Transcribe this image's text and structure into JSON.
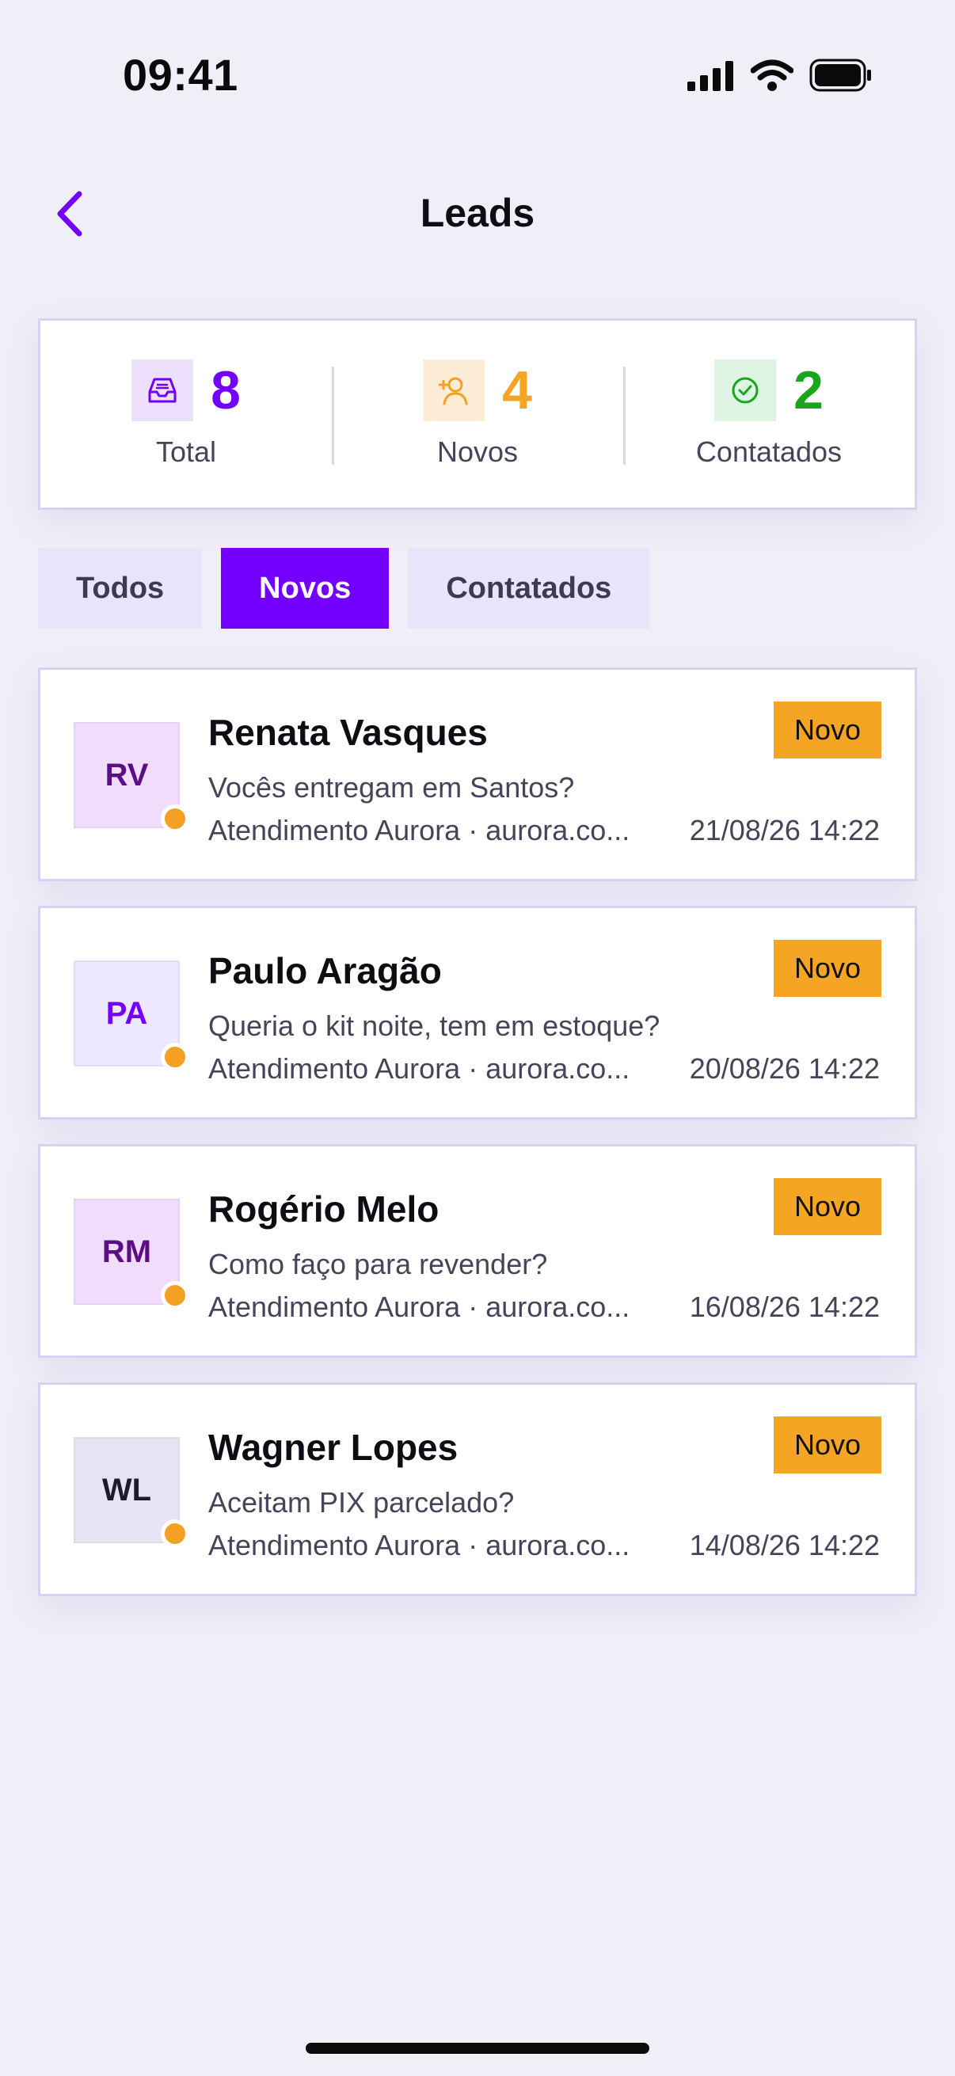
{
  "status_bar": {
    "time": "09:41"
  },
  "nav": {
    "title": "Leads"
  },
  "colors": {
    "accent": "#7300ff",
    "novo": "#f5a524",
    "contacted": "#1aa51a"
  },
  "stats": [
    {
      "value": "8",
      "label": "Total",
      "icon": "inbox-icon",
      "color": "#7300ff"
    },
    {
      "value": "4",
      "label": "Novos",
      "icon": "user-plus-icon",
      "color": "#f5a524"
    },
    {
      "value": "2",
      "label": "Contatados",
      "icon": "check-circle-icon",
      "color": "#1aa51a"
    }
  ],
  "tabs": [
    {
      "label": "Todos",
      "active": false
    },
    {
      "label": "Novos",
      "active": true
    },
    {
      "label": "Contatados",
      "active": false
    }
  ],
  "leads": [
    {
      "initials": "RV",
      "name": "Renata Vasques",
      "message": "Vocês entregam em Santos?",
      "source": "Atendimento Aurora · aurora.co...",
      "date": "21/08/26 14:22",
      "badge": "Novo",
      "avatar_bg": "#f1dcfb",
      "avatar_fg": "#5b0f86"
    },
    {
      "initials": "PA",
      "name": "Paulo Aragão",
      "message": "Queria o kit noite, tem em estoque?",
      "source": "Atendimento Aurora · aurora.co...",
      "date": "20/08/26 14:22",
      "badge": "Novo",
      "avatar_bg": "#ede8fd",
      "avatar_fg": "#7300ff"
    },
    {
      "initials": "RM",
      "name": "Rogério Melo",
      "message": "Como faço para revender?",
      "source": "Atendimento Aurora · aurora.co...",
      "date": "16/08/26 14:22",
      "badge": "Novo",
      "avatar_bg": "#f1dcfb",
      "avatar_fg": "#5b0f86"
    },
    {
      "initials": "WL",
      "name": "Wagner Lopes",
      "message": "Aceitam PIX parcelado?",
      "source": "Atendimento Aurora · aurora.co...",
      "date": "14/08/26 14:22",
      "badge": "Novo",
      "avatar_bg": "#e6e4f4",
      "avatar_fg": "#1c1c2a"
    }
  ]
}
